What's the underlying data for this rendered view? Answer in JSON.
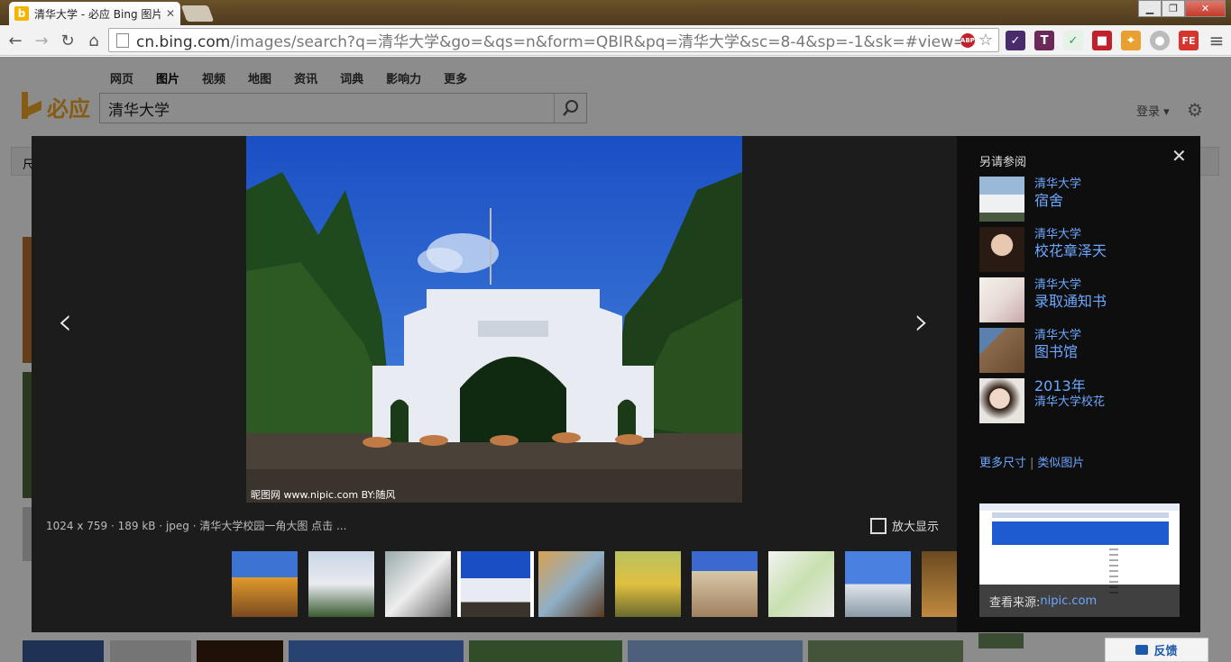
{
  "browser": {
    "tab_title": "清华大学 - 必应 Bing 图片",
    "tab_favicon": "b",
    "url_host": "cn.bing.com",
    "url_path": "/images/search?q=清华大学&go=&qs=n&form=QBIR&pq=清华大学&sc=8-4&sp=-1&sk=#view=detail&id=",
    "abp": "ABP",
    "extensions": [
      "✓",
      "T",
      "✓",
      "■",
      "✦",
      "●",
      "FE"
    ]
  },
  "bing": {
    "scopes": [
      "网页",
      "图片",
      "视频",
      "地图",
      "资讯",
      "词典",
      "影响力",
      "更多"
    ],
    "active_scope": "图片",
    "logo_text": "必应",
    "query": "清华大学",
    "login": "登录 ▾",
    "filter_label": "尺"
  },
  "viewer": {
    "meta": "1024 x 759 · 189 kB · jpeg · 清华大学校园一角大图 点击 ...",
    "fullscreen_label": "放大显示",
    "watermark": "昵图网 www.nipic.com   BY:随风"
  },
  "sidebar": {
    "title": "另请参阅",
    "related": [
      {
        "l1": "清华大学",
        "l2": "宿舍"
      },
      {
        "l1": "清华大学",
        "l2": "校花章泽天"
      },
      {
        "l1": "清华大学",
        "l2": "录取通知书"
      },
      {
        "l1": "清华大学",
        "l2": "图书馆"
      },
      {
        "l1": "2013年",
        "l2": "清华大学校花"
      }
    ],
    "more_sizes": "更多尺寸",
    "sep": "|",
    "similar": "类似图片",
    "source_prefix": "查看来源:",
    "source_host": "nipic.com"
  },
  "feedback": "反馈",
  "colors": {
    "accent_link": "#6da7ff",
    "bing_orange": "#f5a623",
    "viewer_bg": "#1c1c1c"
  }
}
